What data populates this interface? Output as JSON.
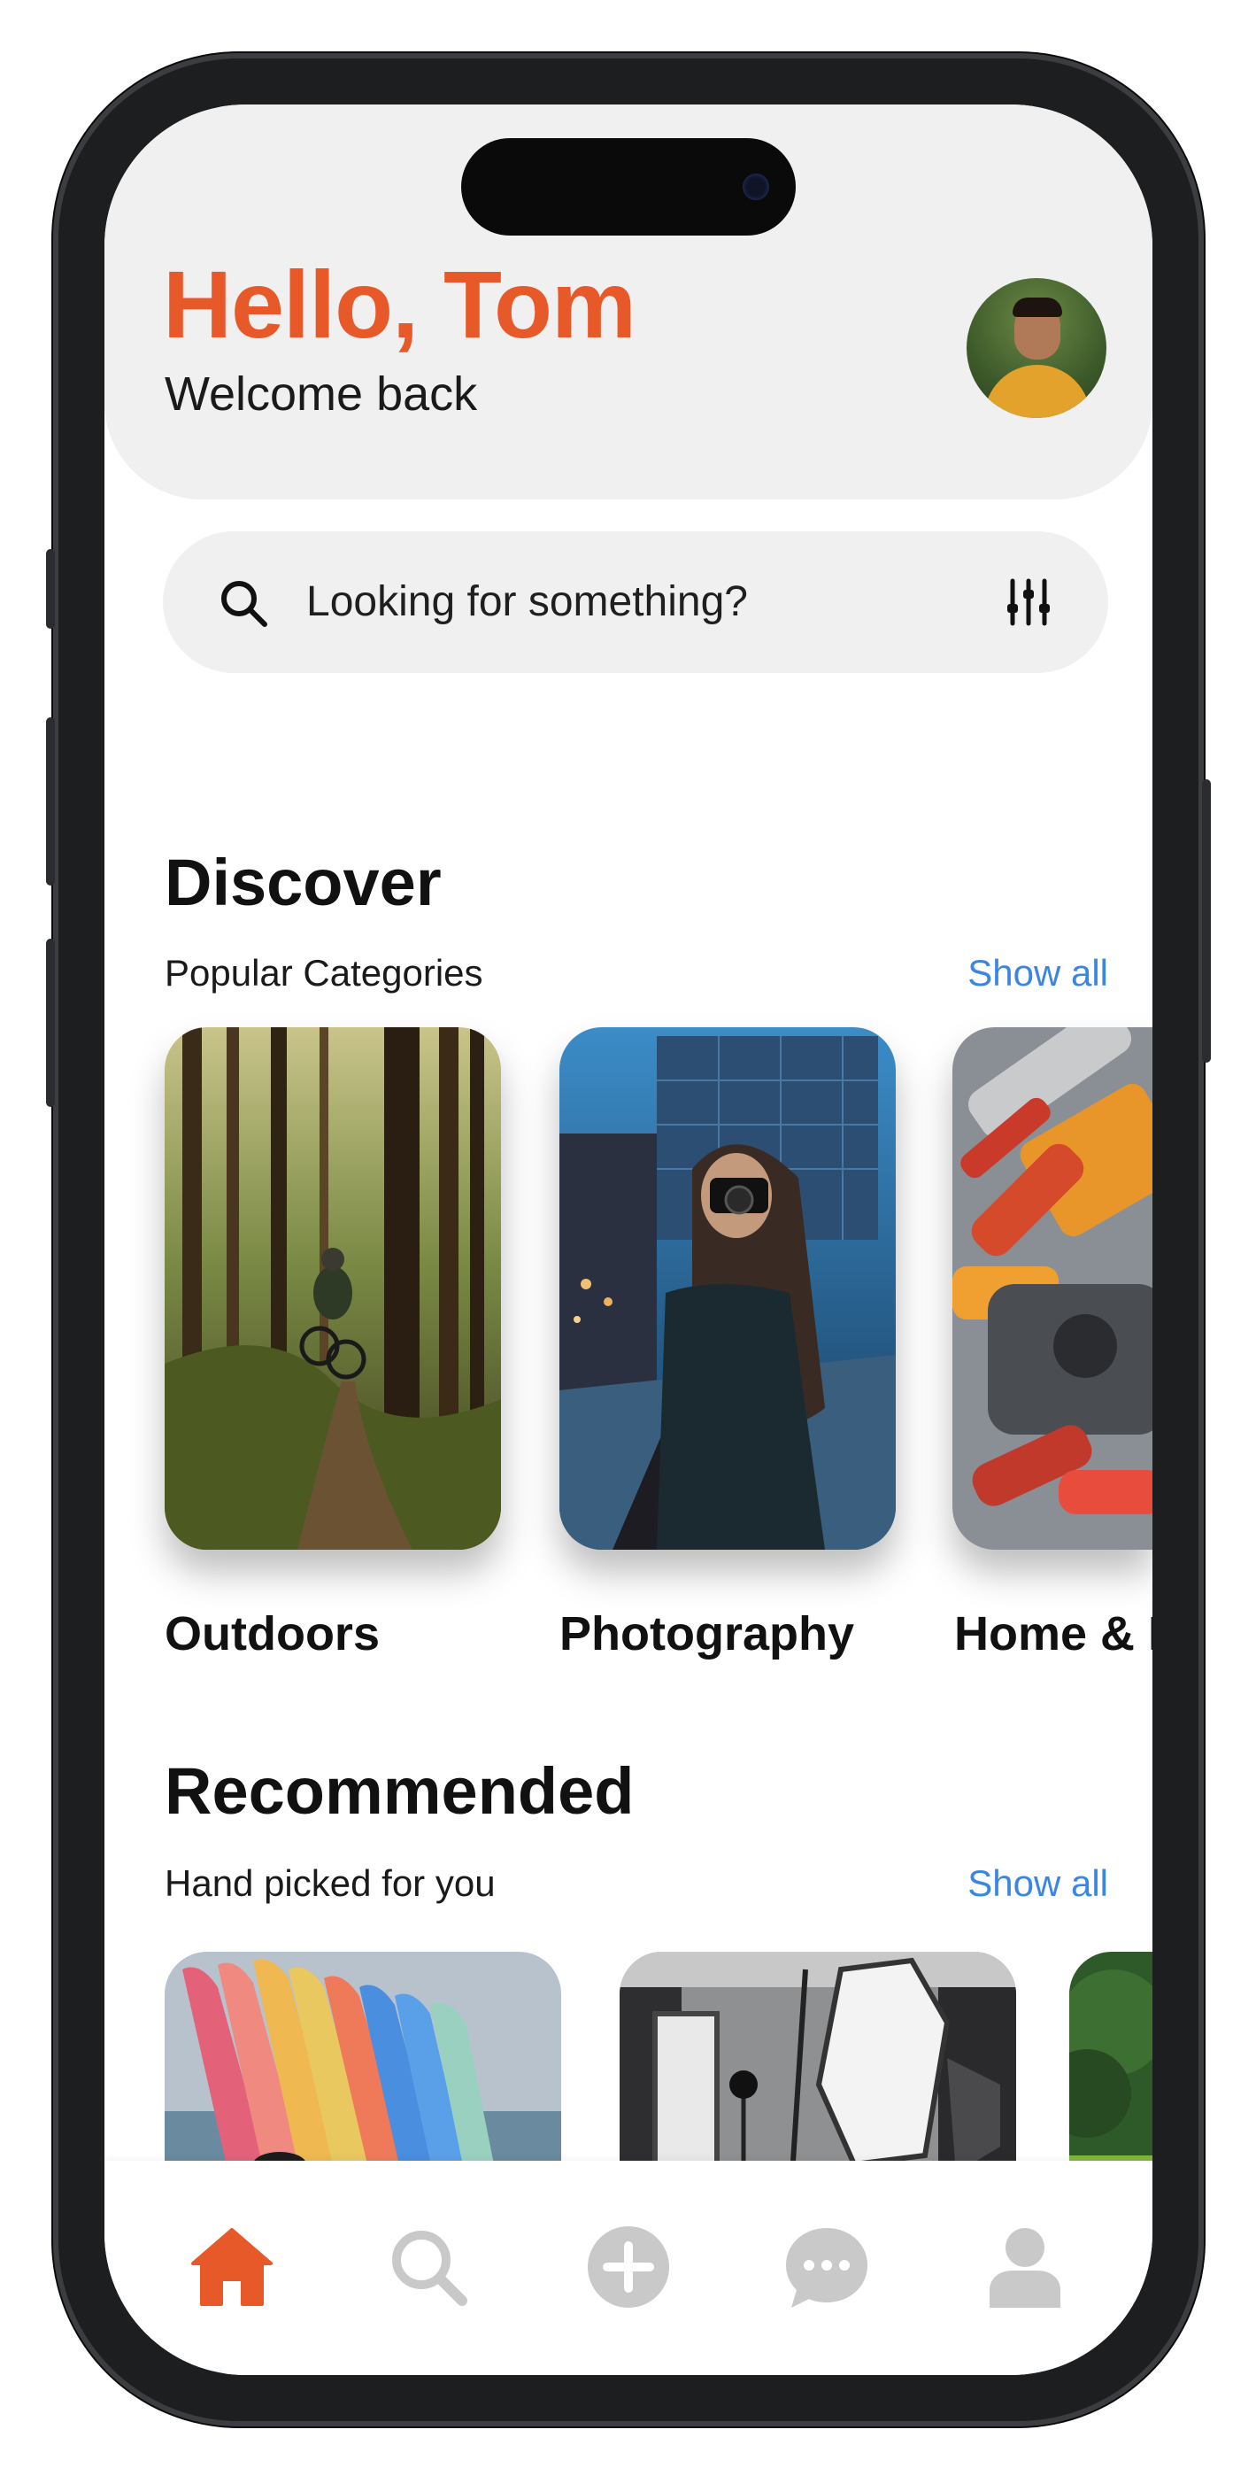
{
  "header": {
    "greeting": "Hello, Tom",
    "subtitle": "Welcome back"
  },
  "search": {
    "placeholder": "Looking for something?"
  },
  "discover": {
    "title": "Discover",
    "subtitle": "Popular Categories",
    "show_all": "Show all",
    "categories": [
      {
        "label": "Outdoors"
      },
      {
        "label": "Photography"
      },
      {
        "label": "Home & I"
      }
    ]
  },
  "recommended": {
    "title": "Recommended",
    "subtitle": "Hand picked for you",
    "show_all": "Show all"
  },
  "tab_bar": {
    "items": [
      "home-icon",
      "search-icon",
      "add-icon",
      "chat-icon",
      "profile-icon"
    ],
    "active": "home-icon"
  },
  "colors": {
    "accent": "#e8592a",
    "link": "#3b86e0",
    "inactive_icon": "#c9c9c9",
    "panel": "#f1f0f0"
  }
}
